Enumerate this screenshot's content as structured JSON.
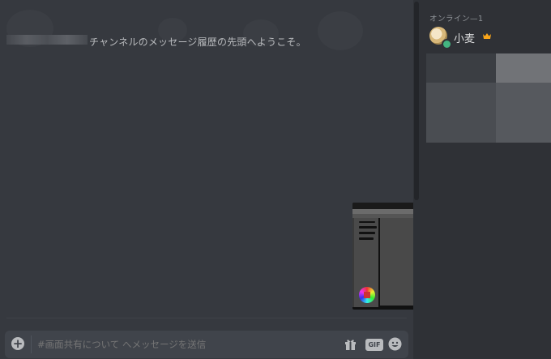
{
  "welcome": {
    "text": "チャンネルのメッセージ履歴の先頭へようこそ。"
  },
  "composer": {
    "placeholder": "#画面共有について へメッセージを送信",
    "gif_label": "GIF"
  },
  "members": {
    "online_header": "オンライン—1",
    "list": [
      {
        "name": "小麦",
        "status": "online",
        "owner": true
      }
    ]
  },
  "colors": {
    "chat_bg": "#36393f",
    "sidebar_bg": "#2f3136",
    "composer_bg": "#40444b",
    "online_green": "#43b581",
    "crown": "#faa61a"
  },
  "icons": {
    "attach": "plus-circle-icon",
    "gift": "gift-icon",
    "gif": "gif-icon",
    "emoji": "emoji-icon",
    "owner": "crown-icon"
  }
}
